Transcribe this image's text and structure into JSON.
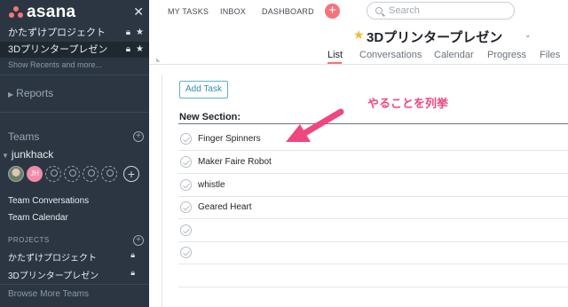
{
  "brand": {
    "logo_text": "asana",
    "accent": "#f5737a"
  },
  "sidebar": {
    "favorites": [
      {
        "label": "かたずけプロジェクト",
        "active": false
      },
      {
        "label": "3Dプリンタープレゼン",
        "active": true
      }
    ],
    "show_recents": "Show Recents and more...",
    "reports": "Reports",
    "teams_label": "Teams",
    "team_name": "junkhack",
    "avatar_initials": "JH",
    "team_links": [
      "Team Conversations",
      "Team Calendar"
    ],
    "projects_label": "PROJECTS",
    "projects": [
      "かたずけプロジェクト",
      "3Dプリンタープレゼン"
    ],
    "browse_more": "Browse More Teams"
  },
  "topnav": {
    "links": [
      "MY TASKS",
      "INBOX",
      "DASHBOARD"
    ],
    "search_placeholder": "Search"
  },
  "project": {
    "title": "3Dプリンタープレゼン",
    "tabs": [
      "List",
      "Conversations",
      "Calendar",
      "Progress",
      "Files"
    ],
    "active_tab": "List"
  },
  "tasks": {
    "add_label": "Add Task",
    "section_title": "New Section:",
    "items": [
      "Finger Spinners",
      "Maker Faire Robot",
      "whistle",
      "Geared Heart",
      "",
      ""
    ]
  },
  "annotation": {
    "text": "やることを列挙",
    "color": "#f1467f"
  }
}
